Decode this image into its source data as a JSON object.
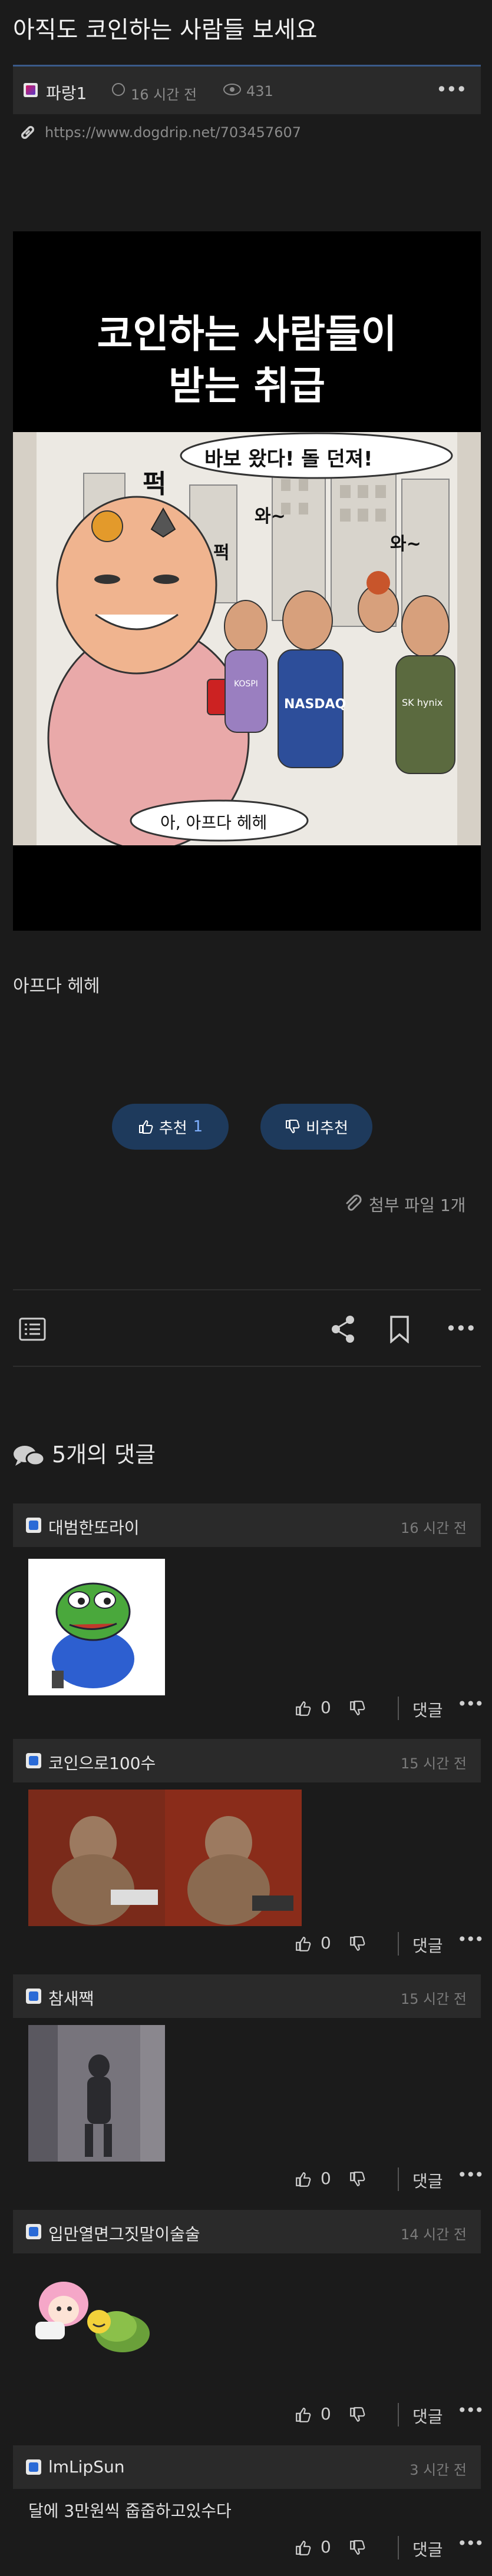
{
  "post": {
    "title": "아직도 코인하는 사람들 보세요",
    "author": "파랑1",
    "time": "16 시간 전",
    "views": "431",
    "url": "https://www.dogdrip.net/703457607",
    "body": "아프다 헤헤",
    "upvote_label": "추천",
    "upvote_count": "1",
    "downvote_label": "비추천",
    "attachments": "첨부 파일 1개"
  },
  "image": {
    "title_line1": "코인하는 사람들이",
    "title_line2": "받는 취급",
    "bubble_top": "바보 왔다! 돌 던져!",
    "bubble_bottom": "아, 아프다 헤헤",
    "sfx1": "퍽",
    "sfx2": "퍽",
    "sfx3": "와~",
    "sfx4": "와~",
    "shirt_kospi": "KOSPI",
    "shirt_nasdaq": "NASDAQ",
    "shirt_sk": "SK hynix"
  },
  "comments_header": "5개의 댓글",
  "comments": [
    {
      "name": "대범한또라이",
      "time": "16 시간 전",
      "text": "",
      "likes": "0",
      "reply": "댓글"
    },
    {
      "name": "코인으로100수",
      "time": "15 시간 전",
      "text": "",
      "likes": "0",
      "reply": "댓글"
    },
    {
      "name": "참새짹",
      "time": "15 시간 전",
      "text": "",
      "likes": "0",
      "reply": "댓글"
    },
    {
      "name": "입만열면그짓말이술술",
      "time": "14 시간 전",
      "text": "",
      "likes": "0",
      "reply": "댓글"
    },
    {
      "name": "lmLipSun",
      "time": "3 시간 전",
      "text": "달에 3만원씩 줍줍하고있수다",
      "likes": "0",
      "reply": "댓글"
    }
  ],
  "colors": {
    "background": "#1b1b1b",
    "card": "#2a2a2a",
    "accent": "#1e3a5c",
    "level": "#2a6ad6"
  }
}
